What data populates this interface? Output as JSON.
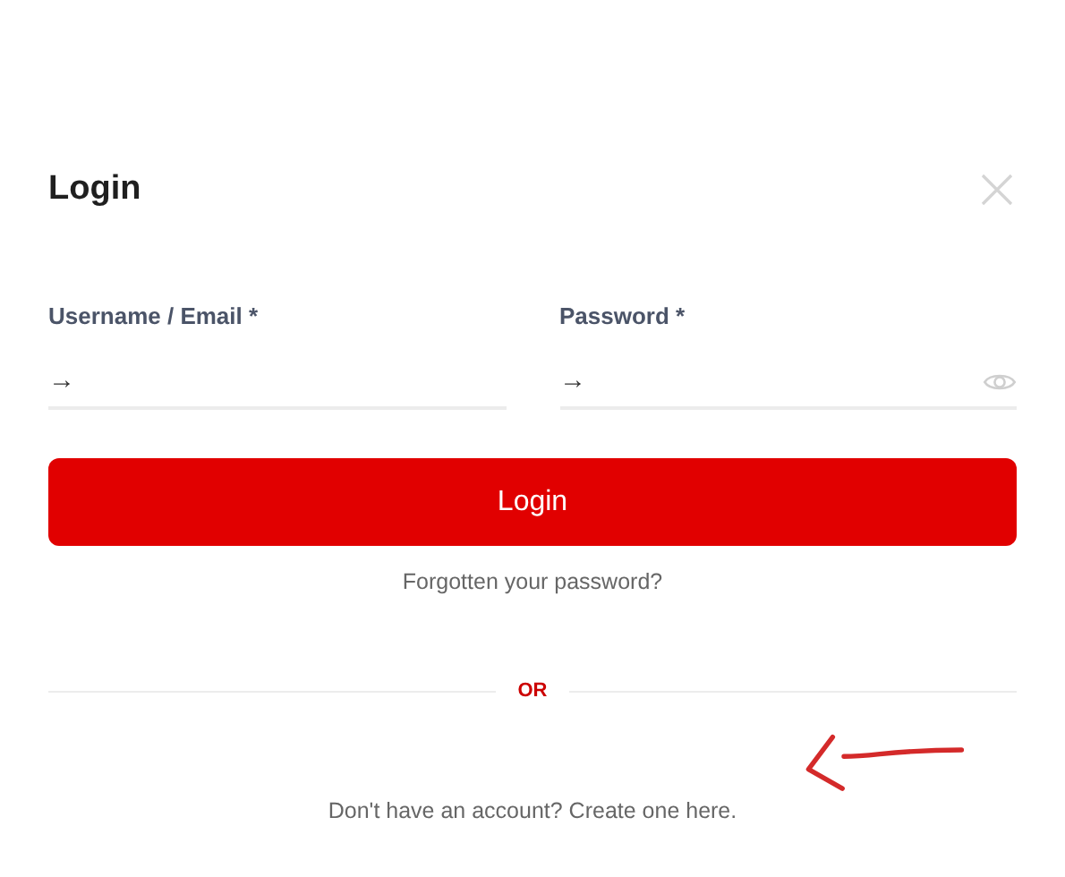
{
  "dialog": {
    "title": "Login"
  },
  "fields": [
    {
      "label": "Username / Email *",
      "placeholder": "→",
      "kind": "text"
    },
    {
      "label": "Password *",
      "placeholder": "→",
      "kind": "password"
    }
  ],
  "submit_button": "Login",
  "forgot_link": "Forgotten your password?",
  "divider_text": "OR",
  "signup_text": "Don't have an account? Create one here."
}
